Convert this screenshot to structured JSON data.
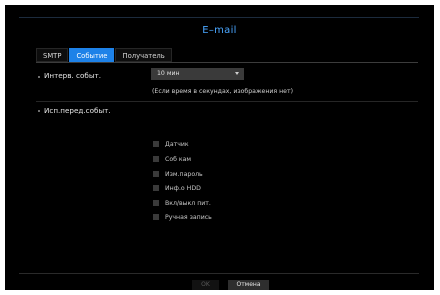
{
  "dialog": {
    "title": "E–mail"
  },
  "tabs": [
    {
      "label": "SMTP",
      "active": false
    },
    {
      "label": "Событие",
      "active": true
    },
    {
      "label": "Получатель",
      "active": false
    }
  ],
  "interval": {
    "label": "Интерв. событ.",
    "value": "10 мин",
    "note": "(Если время в секундах, изображения нет)"
  },
  "events": {
    "label": "Исп.перед.событ.",
    "items": [
      {
        "label": "Датчик",
        "checked": false
      },
      {
        "label": "Соб кам",
        "checked": false
      },
      {
        "label": "Изм.пароль",
        "checked": false
      },
      {
        "label": "Инф.о HDD",
        "checked": false
      },
      {
        "label": "Вкл/выкл пит.",
        "checked": false
      },
      {
        "label": "Ручная запись",
        "checked": false
      }
    ]
  },
  "buttons": {
    "ok": "OK",
    "cancel": "Отмена"
  },
  "colors": {
    "accent": "#1e82e8",
    "title": "#4aa6ff",
    "background": "#000000"
  }
}
